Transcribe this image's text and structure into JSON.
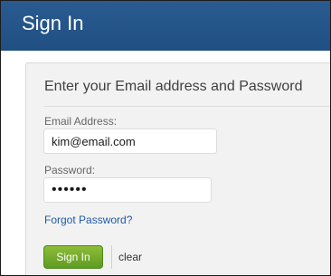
{
  "header": {
    "title": "Sign In",
    "background": "#2a5b90"
  },
  "panel": {
    "title": "Enter your Email address and Password"
  },
  "form": {
    "email_label": "Email Address:",
    "email_value": "kim@email.com",
    "password_label": "Password:",
    "password_value": "••••••",
    "forgot_link": "Forgot Password?",
    "signin_button": "Sign In",
    "clear_link": "clear"
  },
  "colors": {
    "primary_button": "#6aa82a",
    "link": "#1f5aa8",
    "panel_background": "#f2f2f2"
  }
}
